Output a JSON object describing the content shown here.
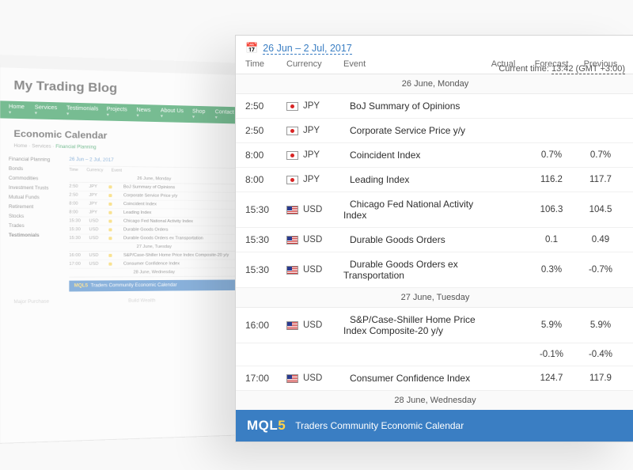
{
  "blog": {
    "title": "My Trading Blog",
    "nav": [
      "Home",
      "Services",
      "Testimonials",
      "Projects",
      "News",
      "About Us",
      "Shop",
      "Contact"
    ],
    "h2": "Economic Calendar",
    "crumb": {
      "a": "Home",
      "b": "Services",
      "c": "Financial Planning"
    },
    "sidebar": [
      "Financial Planning",
      "Bonds",
      "Commodities",
      "Investment Trusts",
      "Mutual Funds",
      "Retirement",
      "Stocks",
      "Trades"
    ],
    "range": "26 Jun – 2 Jul, 2017",
    "header": {
      "time": "Time",
      "cur": "Currency",
      "event": "Event"
    },
    "rows": [
      {
        "day": "26 June, Monday"
      },
      {
        "t": "2:50",
        "c": "JPY",
        "e": "BoJ Summary of Opinions"
      },
      {
        "t": "2:50",
        "c": "JPY",
        "e": "Corporate Service Price y/y"
      },
      {
        "t": "8:00",
        "c": "JPY",
        "e": "Coincident Index"
      },
      {
        "t": "8:00",
        "c": "JPY",
        "e": "Leading Index"
      },
      {
        "t": "15:30",
        "c": "USD",
        "e": "Chicago Fed National Activity Index"
      },
      {
        "t": "15:30",
        "c": "USD",
        "e": "Durable Goods Orders"
      },
      {
        "t": "15:30",
        "c": "USD",
        "e": "Durable Goods Orders ex Transportation"
      },
      {
        "day": "27 June, Tuesday"
      },
      {
        "t": "16:00",
        "c": "USD",
        "e": "S&P/Case-Shiller Home Price Index Composite-20 y/y"
      },
      {
        "t": "17:00",
        "c": "USD",
        "e": "Consumer Confidence Index"
      },
      {
        "day": "28 June, Wednesday"
      }
    ],
    "foot_brand": "MQL5",
    "foot_sub": "Traders Community Economic Calendar",
    "testi_h": "Testimonials",
    "bottom_a": "Major Purchase",
    "bottom_b": "Build Wealth"
  },
  "cal": {
    "range": "26 Jun – 2 Jul, 2017",
    "header": {
      "time": "Time",
      "currency": "Currency",
      "event": "Event",
      "actual": "Actual",
      "forecast": "Forecast",
      "previous": "Previous"
    },
    "clock": {
      "label": "Current time:",
      "value": "13:42 (GMT +3:00)"
    },
    "days": [
      {
        "label": "26 June, Monday",
        "rows": [
          {
            "t": "2:50",
            "cur": "JPY",
            "flag": "jpy",
            "imp": "a",
            "e": "BoJ Summary of Opinions",
            "fore": "",
            "prev": ""
          },
          {
            "t": "2:50",
            "cur": "JPY",
            "flag": "jpy",
            "imp": "g",
            "e": "Corporate Service Price y/y",
            "fore": "",
            "prev": ""
          },
          {
            "t": "8:00",
            "cur": "JPY",
            "flag": "jpy",
            "imp": "a",
            "e": "Coincident Index",
            "fore": "0.7%",
            "prev": "0.7%"
          },
          {
            "t": "8:00",
            "cur": "JPY",
            "flag": "jpy",
            "imp": "a",
            "e": "Leading Index",
            "fore": "116.2",
            "prev": "117.7"
          },
          {
            "t": "15:30",
            "cur": "USD",
            "flag": "usd",
            "imp": "a",
            "e": "Chicago Fed National Activity Index",
            "fore": "106.3",
            "prev": "104.5"
          },
          {
            "t": "15:30",
            "cur": "USD",
            "flag": "usd",
            "imp": "a",
            "e": "Durable Goods Orders",
            "fore": "0.1",
            "prev": "0.49"
          },
          {
            "t": "15:30",
            "cur": "USD",
            "flag": "usd",
            "imp": "a",
            "e": "Durable Goods Orders ex Transportation",
            "fore": "0.3%",
            "prev": "-0.7%"
          }
        ]
      },
      {
        "label": "27 June, Tuesday",
        "rows": [
          {
            "t": "16:00",
            "cur": "USD",
            "flag": "usd",
            "imp": "a",
            "e": "S&P/Case-Shiller Home Price Index Composite-20 y/y",
            "fore": "5.9%",
            "prev": "5.9%",
            "extra_prev": "-0.1%",
            "extra_fore": "-0.4%"
          },
          {
            "t": "17:00",
            "cur": "USD",
            "flag": "usd",
            "imp": "a",
            "e": "Consumer Confidence Index",
            "fore": "124.7",
            "prev": "117.9"
          }
        ]
      },
      {
        "label": "28 June, Wednesday",
        "rows": []
      }
    ],
    "foot": {
      "brand_pre": "MQL",
      "brand_num": "5",
      "sub": "Traders Community Economic Calendar"
    }
  }
}
